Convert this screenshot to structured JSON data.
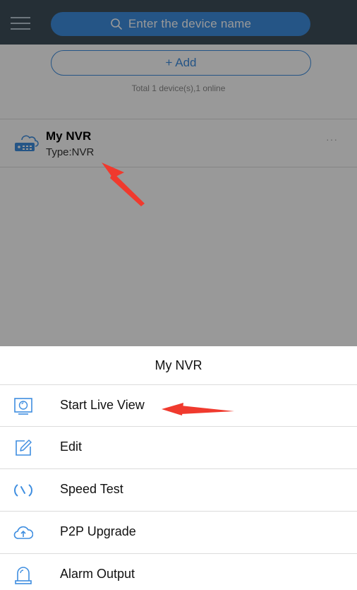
{
  "header": {
    "menu_icon": "hamburger-menu-icon",
    "search_placeholder": "Enter the device name",
    "search_icon": "search-icon"
  },
  "devices": {
    "add_label": "+ Add",
    "total_text": "Total 1 device(s),1 online",
    "items": [
      {
        "name": "My NVR",
        "type": "Type:NVR",
        "more": "···",
        "icon": "nvr-cloud-icon"
      }
    ]
  },
  "action_sheet": {
    "title": "My NVR",
    "items": [
      {
        "label": "Start Live View",
        "icon": "live-view-monitor-icon"
      },
      {
        "label": "Edit",
        "icon": "edit-pencil-icon"
      },
      {
        "label": "Speed Test",
        "icon": "speedometer-icon"
      },
      {
        "label": "P2P Upgrade",
        "icon": "cloud-upload-icon"
      },
      {
        "label": "Alarm Output",
        "icon": "alarm-siren-icon"
      }
    ]
  },
  "colors": {
    "accent": "#3f8ee0",
    "topbar": "#3f4f5a",
    "annotation_arrow": "#f03a2e"
  }
}
